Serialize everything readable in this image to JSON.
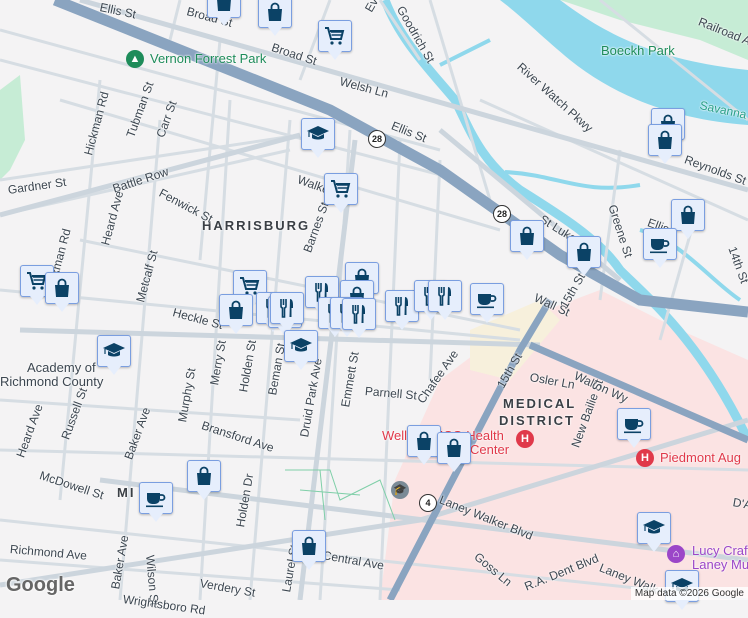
{
  "areas": {
    "harrisburg": "HARRISBURG",
    "medical": "MEDICAL",
    "district": "DISTRICT",
    "midtown_partial": "MI"
  },
  "parks": {
    "vernon": "Vernon Forrest Park",
    "boeckh": "Boeckh Park"
  },
  "water": {
    "savannah": "Savanna"
  },
  "places": {
    "academy_line1": "Academy of",
    "academy_line2": "Richmond County",
    "wellstar_line1": "Wellstar MCG Health",
    "wellstar_line2": "Center",
    "piedmont": "Piedmont Aug",
    "lucy_line1": "Lucy Craft",
    "lucy_line2": "Laney Mu"
  },
  "streets": {
    "ellis1": "Ellis St",
    "broad1": "Broad St",
    "broad2": "Broad St",
    "eve": "Eve St",
    "goodrich": "Goodrich St",
    "welsh": "Welsh Ln",
    "river_watch": "River Watch Pkwy",
    "railroad": "Railroad Ave",
    "ellis2": "Ellis St",
    "reynolds": "Reynolds St",
    "hickman1": "Hickman Rd",
    "tubman": "Tubman St",
    "carr": "Carr St",
    "gardner": "Gardner St",
    "battle_row": "Battle Row",
    "fenwick": "Fenwick St",
    "heard1": "Heard Ave",
    "hickman2": "Hickman Rd",
    "walker": "Walker St",
    "barnes": "Barnes St",
    "st_luke": "St Luke St",
    "greene": "Greene St",
    "ellis3": "Ellis",
    "fourteenth": "14th St",
    "metcalf": "Metcalf St",
    "heckle": "Heckle St",
    "wall": "Wall St",
    "fifteenth1": "15th St",
    "fifteenth2": "15th St",
    "walton": "Walton Wy",
    "osler": "Osler Ln",
    "chafee": "Chafee Ave",
    "parnell": "Parnell St",
    "new_bailie": "New Bailie St",
    "merry": "Merry St",
    "holden1": "Holden St",
    "beman": "Beman St",
    "druid": "Druid Park Ave",
    "emmett": "Emmett St",
    "murphy": "Murphy St",
    "russell": "Russell St",
    "heard2": "Heard Ave",
    "baker1": "Baker Ave",
    "bransford": "Bransford Ave",
    "mcdowell": "McDowell St",
    "holden_dr": "Holden Dr",
    "laney_walker1": "Laney Walker Blvd",
    "laney_walker2": "Laney Walk",
    "rad": "R.A. Dent Blvd",
    "goss": "Goss Ln",
    "richmond": "Richmond Ave",
    "baker2": "Baker Ave",
    "wilson": "Wilson St",
    "verdery": "Verdery St",
    "central": "Central Ave",
    "laurel": "Laurel St",
    "wrightsboro": "Wrightsboro Rd",
    "dantignac": "D'A"
  },
  "route_shields": {
    "r28a": "28",
    "r28b": "28",
    "r4": "4"
  },
  "markers": [
    {
      "type": "shopping"
    },
    {
      "type": "shopping"
    },
    {
      "type": "grocery"
    },
    {
      "type": "education"
    },
    {
      "type": "grocery"
    },
    {
      "type": "shopping"
    },
    {
      "type": "shopping"
    },
    {
      "type": "shopping"
    },
    {
      "type": "shopping"
    },
    {
      "type": "cafe"
    },
    {
      "type": "grocery"
    },
    {
      "type": "shopping"
    },
    {
      "type": "grocery"
    },
    {
      "type": "shopping"
    },
    {
      "type": "shopping"
    },
    {
      "type": "restaurant"
    },
    {
      "type": "restaurant"
    },
    {
      "type": "restaurant"
    },
    {
      "type": "shopping"
    },
    {
      "type": "restaurant"
    },
    {
      "type": "restaurant"
    },
    {
      "type": "restaurant"
    },
    {
      "type": "restaurant"
    },
    {
      "type": "restaurant"
    },
    {
      "type": "restaurant"
    },
    {
      "type": "restaurant"
    },
    {
      "type": "shopping"
    },
    {
      "type": "cafe"
    },
    {
      "type": "education"
    },
    {
      "type": "education"
    },
    {
      "type": "shopping"
    },
    {
      "type": "shopping"
    },
    {
      "type": "cafe"
    },
    {
      "type": "cafe"
    },
    {
      "type": "shopping"
    },
    {
      "type": "shopping"
    },
    {
      "type": "education"
    },
    {
      "type": "education"
    }
  ],
  "footer": {
    "logo": "Google",
    "attribution": "Map data ©2026 Google"
  },
  "colors": {
    "marker_bg": "#e6eefc",
    "marker_icon": "#0b4266",
    "highway": "#8aa4c0",
    "water": "#8fd8ec",
    "medical": "#fbe3e3",
    "park": "#c6ecd5"
  }
}
